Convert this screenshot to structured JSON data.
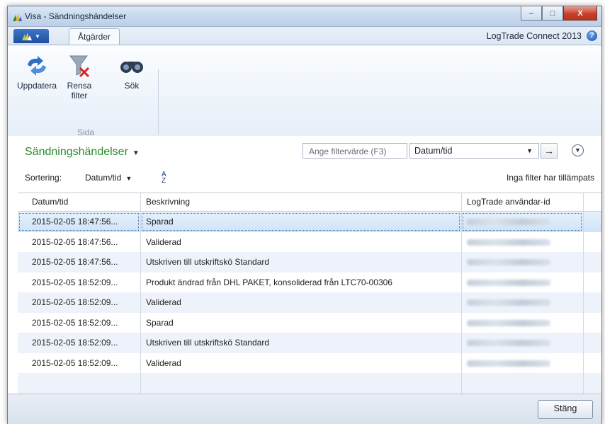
{
  "window": {
    "title": "Visa - Sändningshändelser",
    "controls": {
      "minimize": "–",
      "maximize": "□",
      "close": "X"
    }
  },
  "ribbon": {
    "tab": "Åtgärder",
    "product": "LogTrade Connect 2013",
    "help": "?",
    "buttons": {
      "refresh": "Uppdatera",
      "clear_filter_line1": "Rensa",
      "clear_filter_line2": "filter",
      "search": "Sök"
    },
    "group_label": "Sida"
  },
  "page": {
    "title": "Sändningshändelser",
    "filter_placeholder": "Ange filtervärde (F3)",
    "filter_field": "Datum/tid",
    "sort_label": "Sortering:",
    "sort_field": "Datum/tid",
    "no_filter": "Inga filter har tillämpats"
  },
  "grid": {
    "headers": [
      "Datum/tid",
      "Beskrivning",
      "LogTrade användar-id"
    ],
    "rows": [
      {
        "date": "2015-02-05 18:47:56...",
        "desc": "Sparad"
      },
      {
        "date": "2015-02-05 18:47:56...",
        "desc": "Validerad"
      },
      {
        "date": "2015-02-05 18:47:56...",
        "desc": "Utskriven till utskriftskö Standard"
      },
      {
        "date": "2015-02-05 18:52:09...",
        "desc": "Produkt ändrad från DHL PAKET, konsoliderad från LTC70-00306"
      },
      {
        "date": "2015-02-05 18:52:09...",
        "desc": "Validerad"
      },
      {
        "date": "2015-02-05 18:52:09...",
        "desc": "Sparad"
      },
      {
        "date": "2015-02-05 18:52:09...",
        "desc": "Utskriven till utskriftskö Standard"
      },
      {
        "date": "2015-02-05 18:52:09...",
        "desc": "Validerad"
      }
    ]
  },
  "footer": {
    "close_label": "Stäng"
  },
  "colors": {
    "title_green": "#2a8a2e",
    "selection": "#cfe3f8",
    "alt_row": "#eef3fb"
  }
}
